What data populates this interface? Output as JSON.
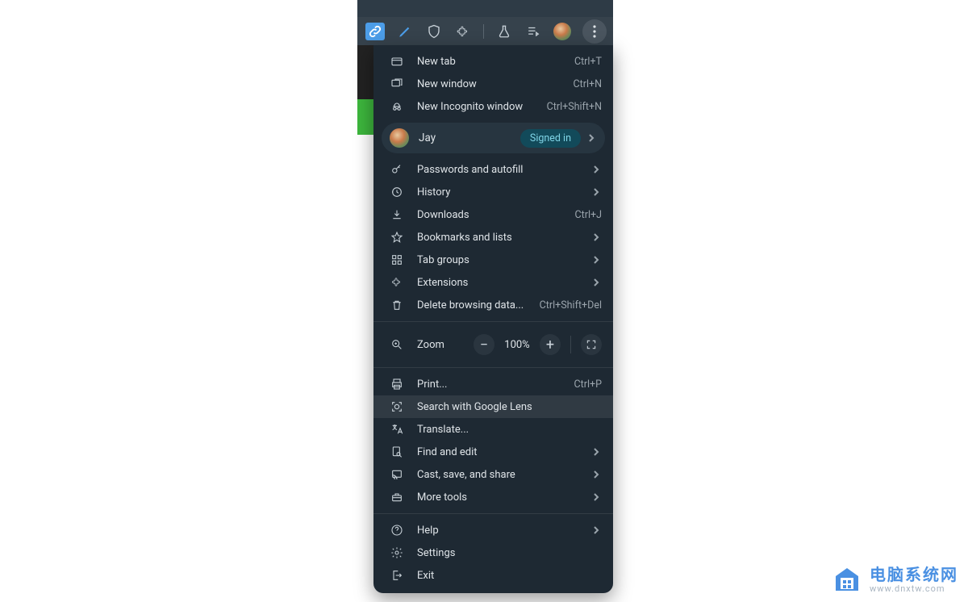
{
  "toolbar": {
    "icons": [
      "link-icon",
      "pen-icon",
      "shield-icon",
      "puzzle-icon",
      "flask-icon",
      "playlist-icon",
      "avatar-icon",
      "kebab-icon"
    ]
  },
  "profile": {
    "name": "Jay",
    "status": "Signed in"
  },
  "menu": {
    "new_tab": "New tab",
    "new_tab_kbd": "Ctrl+T",
    "new_window": "New window",
    "new_window_kbd": "Ctrl+N",
    "new_incognito": "New Incognito window",
    "new_incognito_kbd": "Ctrl+Shift+N",
    "passwords": "Passwords and autofill",
    "history": "History",
    "downloads": "Downloads",
    "downloads_kbd": "Ctrl+J",
    "bookmarks": "Bookmarks and lists",
    "tab_groups": "Tab groups",
    "extensions": "Extensions",
    "delete_data": "Delete browsing data...",
    "delete_data_kbd": "Ctrl+Shift+Del",
    "zoom_label": "Zoom",
    "zoom_value": "100%",
    "print": "Print...",
    "print_kbd": "Ctrl+P",
    "search_lens": "Search with Google Lens",
    "translate": "Translate...",
    "find_edit": "Find and edit",
    "cast_save_share": "Cast, save, and share",
    "more_tools": "More tools",
    "help": "Help",
    "settings": "Settings",
    "exit": "Exit"
  },
  "watermark": {
    "cn": "电脑系统网",
    "url": "www.dnxtw.com"
  }
}
